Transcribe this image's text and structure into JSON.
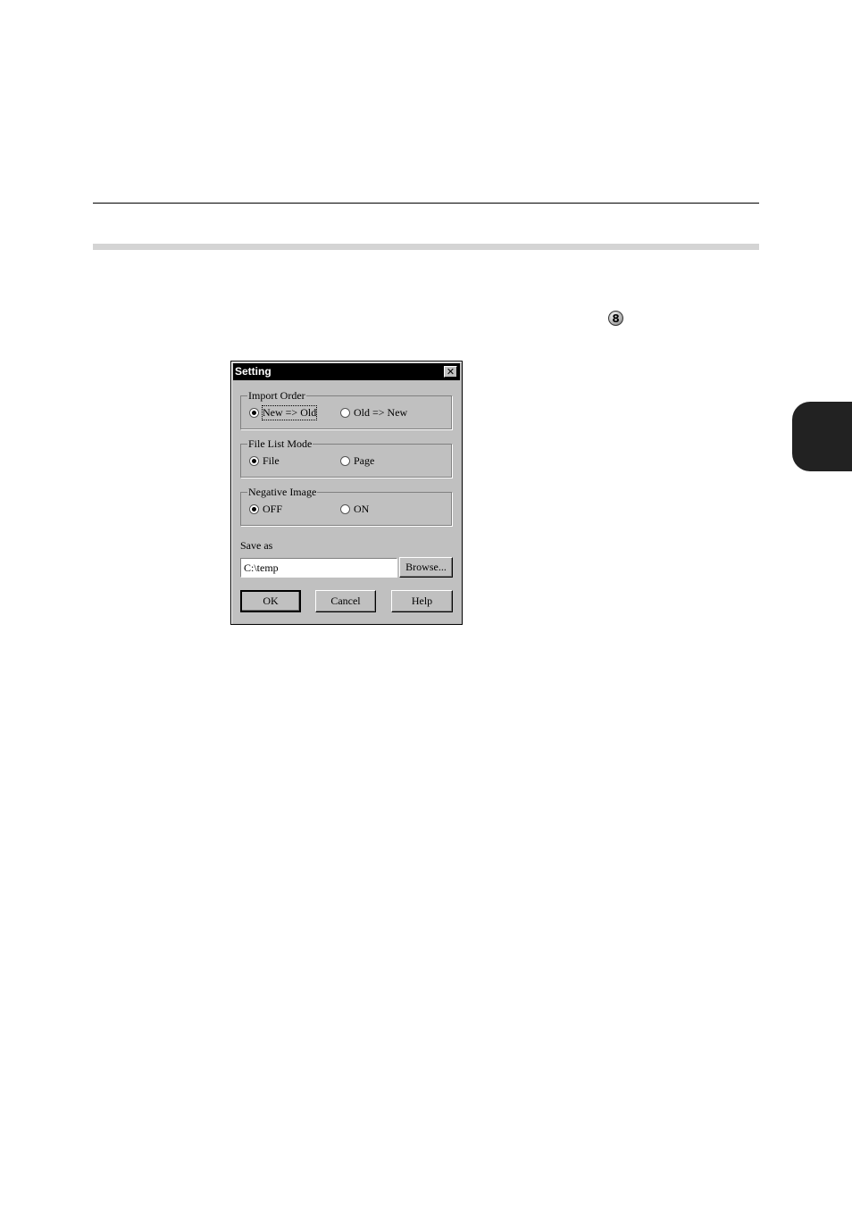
{
  "document": {
    "step_number": "8"
  },
  "dialog": {
    "title": "Setting",
    "close_glyph": "✕",
    "import_order": {
      "label": "Import Order",
      "options": [
        "New => Old",
        "Old => New"
      ],
      "selected": "New => Old"
    },
    "file_list_mode": {
      "label": "File List Mode",
      "options": [
        "File",
        "Page"
      ],
      "selected": "File"
    },
    "negative_image": {
      "label": "Negative Image",
      "options": [
        "OFF",
        "ON"
      ],
      "selected": "OFF"
    },
    "save_as": {
      "label": "Save as",
      "value": "C:\\temp",
      "browse_label": "Browse..."
    },
    "buttons": {
      "ok": "OK",
      "cancel": "Cancel",
      "help": "Help"
    }
  }
}
